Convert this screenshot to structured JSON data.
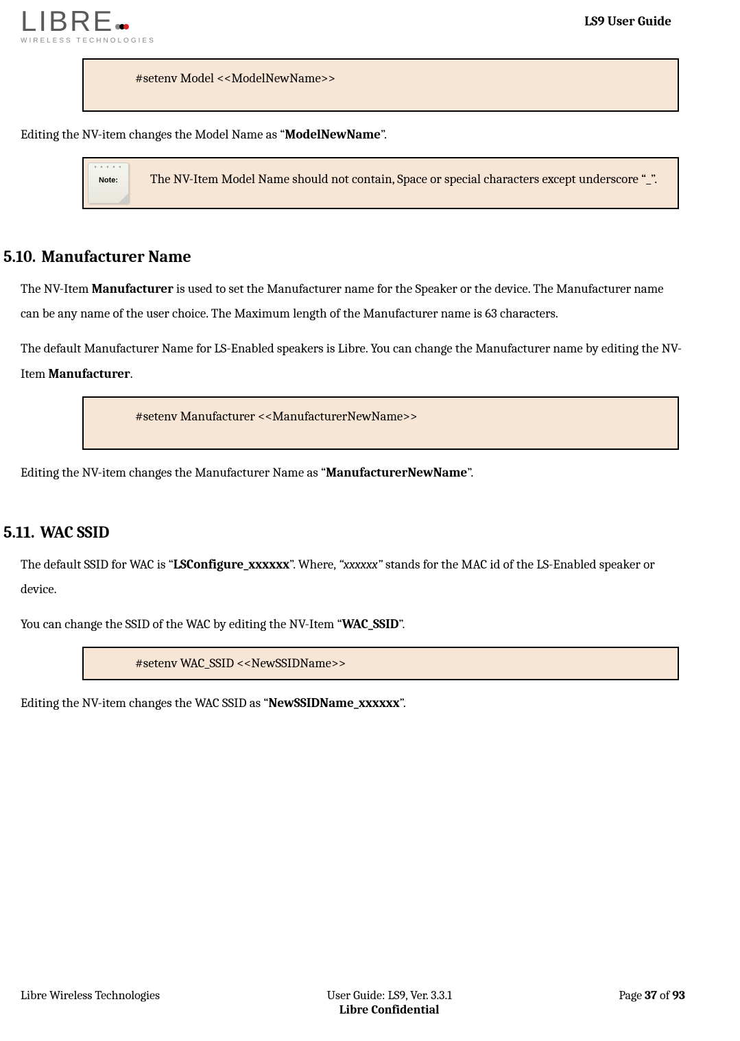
{
  "header": {
    "logo_main": "LIBRE",
    "logo_sub": "WIRELESS TECHNOLOGIES",
    "doc_title": "LS9 User Guide"
  },
  "cmd1": "#setenv Model <<ModelNewName>>",
  "para1_a": "Editing the NV-item changes the Model Name as “",
  "para1_b": "ModelNewName",
  "para1_c": "”.",
  "note1": {
    "label": "Note:",
    "text": "The NV-Item Model Name should not contain, Space or special characters except  underscore “_”."
  },
  "section510": {
    "num": "5.10.",
    "title": "Manufacturer Name",
    "p1_a": "The NV-Item ",
    "p1_b": "Manufacturer",
    "p1_c": " is used to set the Manufacturer name for the Speaker or the device. The Manufacturer name can be any name of the user choice. The Maximum length of the Manufacturer name is 63 characters.",
    "p2_a": "The default Manufacturer Name for LS-Enabled speakers is Libre. You can change the Manufacturer name by editing the NV-Item ",
    "p2_b": "Manufacturer",
    "p2_c": ".",
    "cmd": "#setenv Manufacturer <<ManufacturerNewName>>",
    "p3_a": "Editing the NV-item changes the Manufacturer Name as “",
    "p3_b": "ManufacturerNewName",
    "p3_c": "”."
  },
  "section511": {
    "num": "5.11.",
    "title": "WAC SSID",
    "p1_a": "The default SSID for WAC is “",
    "p1_b": "LSConfigure_xxxxxx",
    "p1_c": "”. Where, ",
    "p1_d": "“xxxxxx”",
    "p1_e": " stands for the MAC id of the LS-Enabled speaker or device.",
    "p2_a": "You can change the SSID of the WAC by editing the NV-Item “",
    "p2_b": "WAC_SSID",
    "p2_c": "”.",
    "cmd": "#setenv WAC_SSID <<NewSSIDName>>",
    "p3_a": "Editing the NV-item changes the WAC SSID as “",
    "p3_b": "NewSSIDName_xxxxxx",
    "p3_c": "”."
  },
  "footer": {
    "left": "Libre Wireless Technologies",
    "center1": "User Guide: LS9, Ver. 3.3.1",
    "center2": "Libre Confidential",
    "right_a": "Page ",
    "right_b": "37",
    "right_c": " of ",
    "right_d": "93"
  }
}
